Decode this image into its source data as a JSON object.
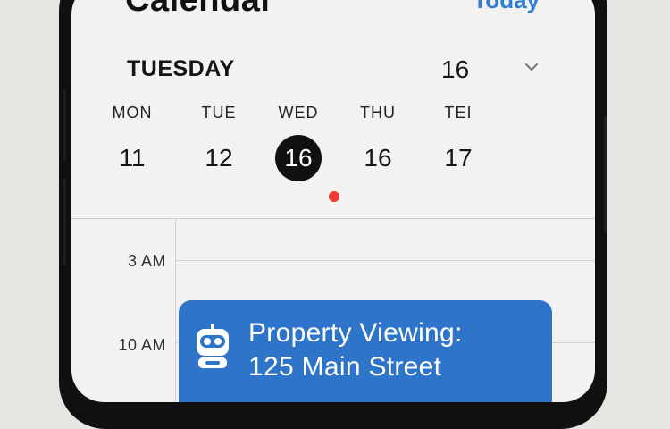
{
  "header": {
    "title": "Calendar",
    "today_label": "Today"
  },
  "date_selector": {
    "day_name": "TUESDAY",
    "date": "16"
  },
  "week": [
    {
      "day": "MON",
      "date": "11",
      "selected": false
    },
    {
      "day": "TUE",
      "date": "12",
      "selected": false
    },
    {
      "day": "WED",
      "date": "16",
      "selected": true
    },
    {
      "day": "THU",
      "date": "16",
      "selected": false
    },
    {
      "day": "TEI",
      "date": "17",
      "selected": false
    }
  ],
  "timeline": {
    "times": [
      "3 AM",
      "10 AM"
    ]
  },
  "event": {
    "title_line1": "Property Viewing:",
    "title_line2": "125 Main Street",
    "icon": "robot-icon",
    "color": "#2e74c8"
  },
  "colors": {
    "accent": "#2f7fd3",
    "event_dot": "#ee3b35"
  }
}
